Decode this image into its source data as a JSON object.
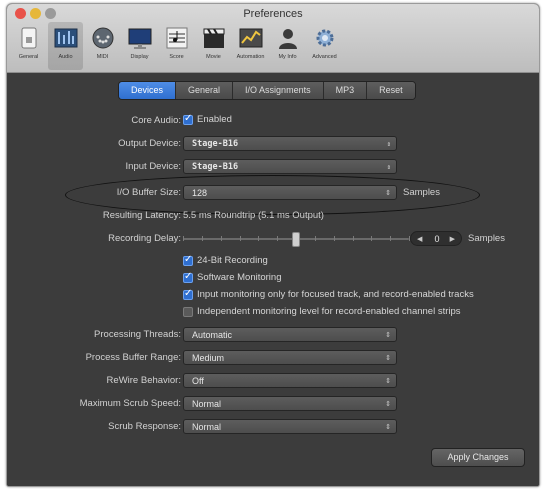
{
  "window": {
    "title": "Preferences"
  },
  "toolbar": {
    "items": [
      {
        "label": "General",
        "icon": "general-switch-icon"
      },
      {
        "label": "Audio",
        "icon": "audio-mixer-icon"
      },
      {
        "label": "MIDI",
        "icon": "midi-connector-icon"
      },
      {
        "label": "Display",
        "icon": "display-monitor-icon"
      },
      {
        "label": "Score",
        "icon": "score-notation-icon"
      },
      {
        "label": "Movie",
        "icon": "movie-clapper-icon"
      },
      {
        "label": "Automation",
        "icon": "automation-curve-icon"
      },
      {
        "label": "My Info",
        "icon": "person-silhouette-icon"
      },
      {
        "label": "Advanced",
        "icon": "advanced-gear-icon"
      }
    ]
  },
  "tabs": [
    {
      "label": "Devices",
      "active": true
    },
    {
      "label": "General",
      "active": false
    },
    {
      "label": "I/O Assignments",
      "active": false
    },
    {
      "label": "MP3",
      "active": false
    },
    {
      "label": "Reset",
      "active": false
    }
  ],
  "core_audio": {
    "label": "Core Audio:",
    "checkbox_label": "Enabled",
    "checked": true
  },
  "output_device": {
    "label": "Output Device:",
    "value": "Stage-B16"
  },
  "input_device": {
    "label": "Input Device:",
    "value": "Stage-B16"
  },
  "io_buffer": {
    "label": "I/O Buffer Size:",
    "value": "128",
    "unit": "Samples"
  },
  "latency": {
    "label": "Resulting Latency:",
    "value": "5.5 ms Roundtrip (5.1 ms Output)"
  },
  "recording_delay": {
    "label": "Recording Delay:",
    "value": "0",
    "unit": "Samples",
    "position": 0.5
  },
  "options": [
    {
      "label": "24-Bit Recording",
      "checked": true
    },
    {
      "label": "Software Monitoring",
      "checked": true
    },
    {
      "label": "Input monitoring only for focused track, and record-enabled tracks",
      "checked": true
    },
    {
      "label": "Independent monitoring level for record-enabled channel strips",
      "checked": false
    }
  ],
  "processing_threads": {
    "label": "Processing Threads:",
    "value": "Automatic"
  },
  "process_buffer_range": {
    "label": "Process Buffer Range:",
    "value": "Medium"
  },
  "rewire_behavior": {
    "label": "ReWire Behavior:",
    "value": "Off"
  },
  "max_scrub_speed": {
    "label": "Maximum Scrub Speed:",
    "value": "Normal"
  },
  "scrub_response": {
    "label": "Scrub Response:",
    "value": "Normal"
  },
  "apply_button": {
    "label": "Apply Changes"
  },
  "colors": {
    "accent": "#2f6fcf",
    "panel_bg": "#3c3c3c",
    "toolbar_bg": "#c8c8c8"
  }
}
